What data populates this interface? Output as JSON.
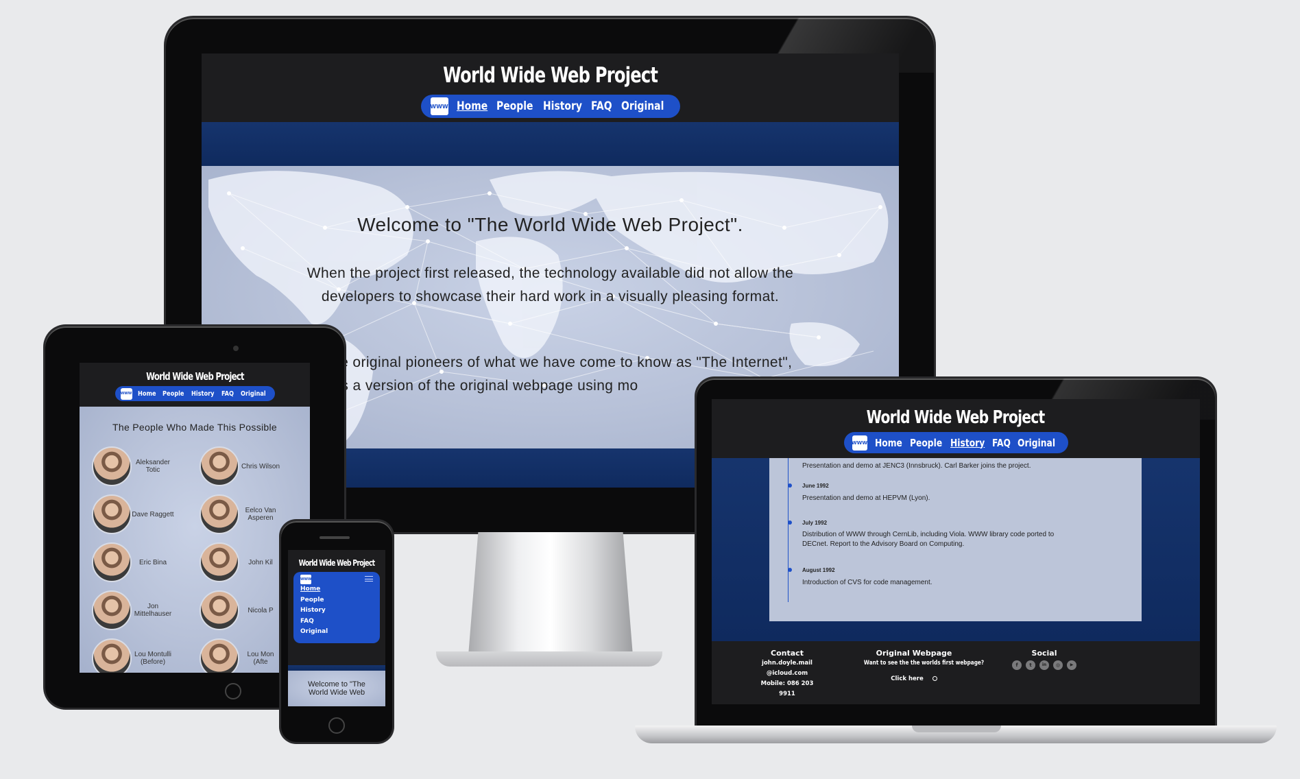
{
  "site": {
    "title": "World Wide Web Project",
    "logo_text": "WWW",
    "nav": [
      "Home",
      "People",
      "History",
      "FAQ",
      "Original"
    ]
  },
  "desktop": {
    "welcome_heading": "Welcome to \"The World Wide Web Project\".",
    "para1_line1": "When the project first released, the technology available did not allow the",
    "para1_line2": "developers to showcase their hard work in a visually pleasing format.",
    "para2_line1": "he original pioneers of what we have come to know as \"The Internet\",",
    "para2_line2": "e is a version of the original webpage using mo"
  },
  "tablet": {
    "people_heading": "The People Who Made This Possible",
    "people": [
      {
        "name": "Aleksander Totic"
      },
      {
        "name": "Chris Wilson"
      },
      {
        "name": "Dave Raggett"
      },
      {
        "name": "Eelco Van Asperen"
      },
      {
        "name": "Eric Bina"
      },
      {
        "name": "John Kil"
      },
      {
        "name": "Jon Mittelhauser"
      },
      {
        "name": "Nicola P"
      },
      {
        "name": "Lou Montulli (Before)"
      },
      {
        "name": "Lou Mon (Afte"
      }
    ]
  },
  "phone": {
    "menu_icon": "hamburger-icon",
    "welcome_line1": "Welcome to \"The",
    "welcome_line2": "World Wide Web"
  },
  "laptop": {
    "timeline": [
      {
        "date": "",
        "text": "Presentation and demo at JENC3 (Innsbruck). Carl Barker joins the project."
      },
      {
        "date": "June 1992",
        "text": "Presentation and demo at HEPVM (Lyon)."
      },
      {
        "date": "July 1992",
        "text_line1": "Distribution of WWW through CernLib, including Viola. WWW library code ported to",
        "text_line2": "DECnet. Report to the Advisory Board on Computing."
      },
      {
        "date": "August 1992",
        "text": "Introduction of CVS for code management."
      }
    ],
    "footer": {
      "contact_heading": "Contact",
      "contact_email_line1": "john.doyle.mail",
      "contact_email_line2": "@icloud.com",
      "contact_mobile": "Mobile: 086 203 9911",
      "original_heading": "Original Webpage",
      "original_text": "Want to see the the worlds first webpage?",
      "original_link": "Click here",
      "social_heading": "Social",
      "social_icons": [
        "facebook-icon",
        "twitter-icon",
        "linkedin-icon",
        "instagram-icon",
        "youtube-icon"
      ]
    }
  },
  "colors": {
    "nav_blue": "#1e50c8",
    "header_dark": "#1d1d1f",
    "band_navy": "#16346d",
    "background": "#e9eaec"
  }
}
